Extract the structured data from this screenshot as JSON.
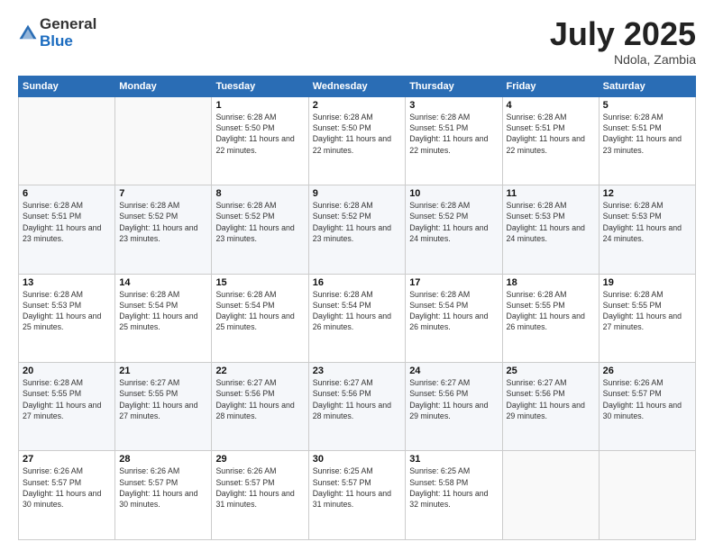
{
  "logo": {
    "general": "General",
    "blue": "Blue"
  },
  "title": {
    "month": "July 2025",
    "location": "Ndola, Zambia"
  },
  "header_days": [
    "Sunday",
    "Monday",
    "Tuesday",
    "Wednesday",
    "Thursday",
    "Friday",
    "Saturday"
  ],
  "weeks": [
    [
      {
        "day": "",
        "sunrise": "",
        "sunset": "",
        "daylight": ""
      },
      {
        "day": "",
        "sunrise": "",
        "sunset": "",
        "daylight": ""
      },
      {
        "day": "1",
        "sunrise": "Sunrise: 6:28 AM",
        "sunset": "Sunset: 5:50 PM",
        "daylight": "Daylight: 11 hours and 22 minutes."
      },
      {
        "day": "2",
        "sunrise": "Sunrise: 6:28 AM",
        "sunset": "Sunset: 5:50 PM",
        "daylight": "Daylight: 11 hours and 22 minutes."
      },
      {
        "day": "3",
        "sunrise": "Sunrise: 6:28 AM",
        "sunset": "Sunset: 5:51 PM",
        "daylight": "Daylight: 11 hours and 22 minutes."
      },
      {
        "day": "4",
        "sunrise": "Sunrise: 6:28 AM",
        "sunset": "Sunset: 5:51 PM",
        "daylight": "Daylight: 11 hours and 22 minutes."
      },
      {
        "day": "5",
        "sunrise": "Sunrise: 6:28 AM",
        "sunset": "Sunset: 5:51 PM",
        "daylight": "Daylight: 11 hours and 23 minutes."
      }
    ],
    [
      {
        "day": "6",
        "sunrise": "Sunrise: 6:28 AM",
        "sunset": "Sunset: 5:51 PM",
        "daylight": "Daylight: 11 hours and 23 minutes."
      },
      {
        "day": "7",
        "sunrise": "Sunrise: 6:28 AM",
        "sunset": "Sunset: 5:52 PM",
        "daylight": "Daylight: 11 hours and 23 minutes."
      },
      {
        "day": "8",
        "sunrise": "Sunrise: 6:28 AM",
        "sunset": "Sunset: 5:52 PM",
        "daylight": "Daylight: 11 hours and 23 minutes."
      },
      {
        "day": "9",
        "sunrise": "Sunrise: 6:28 AM",
        "sunset": "Sunset: 5:52 PM",
        "daylight": "Daylight: 11 hours and 23 minutes."
      },
      {
        "day": "10",
        "sunrise": "Sunrise: 6:28 AM",
        "sunset": "Sunset: 5:52 PM",
        "daylight": "Daylight: 11 hours and 24 minutes."
      },
      {
        "day": "11",
        "sunrise": "Sunrise: 6:28 AM",
        "sunset": "Sunset: 5:53 PM",
        "daylight": "Daylight: 11 hours and 24 minutes."
      },
      {
        "day": "12",
        "sunrise": "Sunrise: 6:28 AM",
        "sunset": "Sunset: 5:53 PM",
        "daylight": "Daylight: 11 hours and 24 minutes."
      }
    ],
    [
      {
        "day": "13",
        "sunrise": "Sunrise: 6:28 AM",
        "sunset": "Sunset: 5:53 PM",
        "daylight": "Daylight: 11 hours and 25 minutes."
      },
      {
        "day": "14",
        "sunrise": "Sunrise: 6:28 AM",
        "sunset": "Sunset: 5:54 PM",
        "daylight": "Daylight: 11 hours and 25 minutes."
      },
      {
        "day": "15",
        "sunrise": "Sunrise: 6:28 AM",
        "sunset": "Sunset: 5:54 PM",
        "daylight": "Daylight: 11 hours and 25 minutes."
      },
      {
        "day": "16",
        "sunrise": "Sunrise: 6:28 AM",
        "sunset": "Sunset: 5:54 PM",
        "daylight": "Daylight: 11 hours and 26 minutes."
      },
      {
        "day": "17",
        "sunrise": "Sunrise: 6:28 AM",
        "sunset": "Sunset: 5:54 PM",
        "daylight": "Daylight: 11 hours and 26 minutes."
      },
      {
        "day": "18",
        "sunrise": "Sunrise: 6:28 AM",
        "sunset": "Sunset: 5:55 PM",
        "daylight": "Daylight: 11 hours and 26 minutes."
      },
      {
        "day": "19",
        "sunrise": "Sunrise: 6:28 AM",
        "sunset": "Sunset: 5:55 PM",
        "daylight": "Daylight: 11 hours and 27 minutes."
      }
    ],
    [
      {
        "day": "20",
        "sunrise": "Sunrise: 6:28 AM",
        "sunset": "Sunset: 5:55 PM",
        "daylight": "Daylight: 11 hours and 27 minutes."
      },
      {
        "day": "21",
        "sunrise": "Sunrise: 6:27 AM",
        "sunset": "Sunset: 5:55 PM",
        "daylight": "Daylight: 11 hours and 27 minutes."
      },
      {
        "day": "22",
        "sunrise": "Sunrise: 6:27 AM",
        "sunset": "Sunset: 5:56 PM",
        "daylight": "Daylight: 11 hours and 28 minutes."
      },
      {
        "day": "23",
        "sunrise": "Sunrise: 6:27 AM",
        "sunset": "Sunset: 5:56 PM",
        "daylight": "Daylight: 11 hours and 28 minutes."
      },
      {
        "day": "24",
        "sunrise": "Sunrise: 6:27 AM",
        "sunset": "Sunset: 5:56 PM",
        "daylight": "Daylight: 11 hours and 29 minutes."
      },
      {
        "day": "25",
        "sunrise": "Sunrise: 6:27 AM",
        "sunset": "Sunset: 5:56 PM",
        "daylight": "Daylight: 11 hours and 29 minutes."
      },
      {
        "day": "26",
        "sunrise": "Sunrise: 6:26 AM",
        "sunset": "Sunset: 5:57 PM",
        "daylight": "Daylight: 11 hours and 30 minutes."
      }
    ],
    [
      {
        "day": "27",
        "sunrise": "Sunrise: 6:26 AM",
        "sunset": "Sunset: 5:57 PM",
        "daylight": "Daylight: 11 hours and 30 minutes."
      },
      {
        "day": "28",
        "sunrise": "Sunrise: 6:26 AM",
        "sunset": "Sunset: 5:57 PM",
        "daylight": "Daylight: 11 hours and 30 minutes."
      },
      {
        "day": "29",
        "sunrise": "Sunrise: 6:26 AM",
        "sunset": "Sunset: 5:57 PM",
        "daylight": "Daylight: 11 hours and 31 minutes."
      },
      {
        "day": "30",
        "sunrise": "Sunrise: 6:25 AM",
        "sunset": "Sunset: 5:57 PM",
        "daylight": "Daylight: 11 hours and 31 minutes."
      },
      {
        "day": "31",
        "sunrise": "Sunrise: 6:25 AM",
        "sunset": "Sunset: 5:58 PM",
        "daylight": "Daylight: 11 hours and 32 minutes."
      },
      {
        "day": "",
        "sunrise": "",
        "sunset": "",
        "daylight": ""
      },
      {
        "day": "",
        "sunrise": "",
        "sunset": "",
        "daylight": ""
      }
    ]
  ]
}
